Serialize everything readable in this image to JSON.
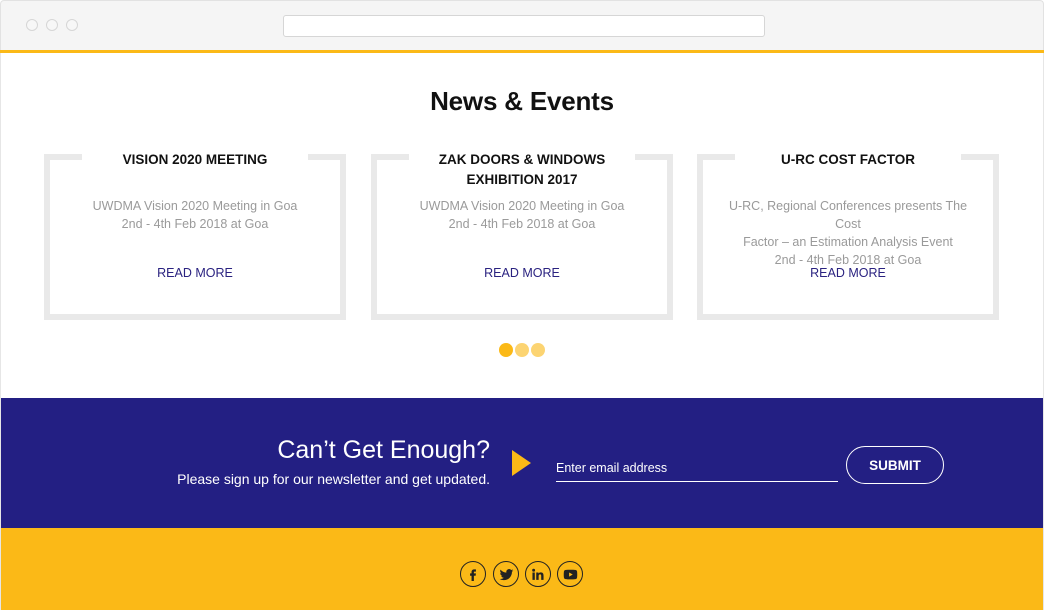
{
  "news": {
    "title": "News & Events",
    "cards": [
      {
        "title_lines": [
          "VISION 2020 MEETING"
        ],
        "desc_lines": [
          "UWDMA Vision 2020 Meeting in Goa",
          "2nd - 4th Feb 2018 at Goa"
        ],
        "link": "READ MORE"
      },
      {
        "title_lines": [
          "ZAK DOORS & WINDOWS",
          "EXHIBITION 2017"
        ],
        "desc_lines": [
          "UWDMA Vision 2020 Meeting in Goa",
          "2nd - 4th Feb 2018 at Goa"
        ],
        "link": "READ MORE"
      },
      {
        "title_lines": [
          "U-RC COST FACTOR"
        ],
        "desc_lines": [
          "U-RC, Regional Conferences presents The Cost",
          "Factor – an Estimation Analysis Event",
          "2nd - 4th Feb 2018 at Goa"
        ],
        "link": "READ MORE"
      }
    ],
    "pager": {
      "count": 3,
      "active_index": 0,
      "active_color": "#fbb917",
      "inactive_color": "#fcd472"
    }
  },
  "newsletter": {
    "heading": "Can’t Get Enough?",
    "subheading": "Please sign up for our newsletter and get updated.",
    "email_placeholder": "Enter email address",
    "submit_label": "SUBMIT",
    "background": "#231f83",
    "arrow_color": "#fbb917"
  },
  "footer": {
    "background": "#fbb917",
    "social_icons": [
      "facebook-icon",
      "twitter-icon",
      "linkedin-icon",
      "youtube-icon"
    ]
  },
  "colors": {
    "accent": "#fbb917",
    "primary": "#231f83",
    "link": "#2a2280",
    "muted_text": "#9a9a9a"
  }
}
